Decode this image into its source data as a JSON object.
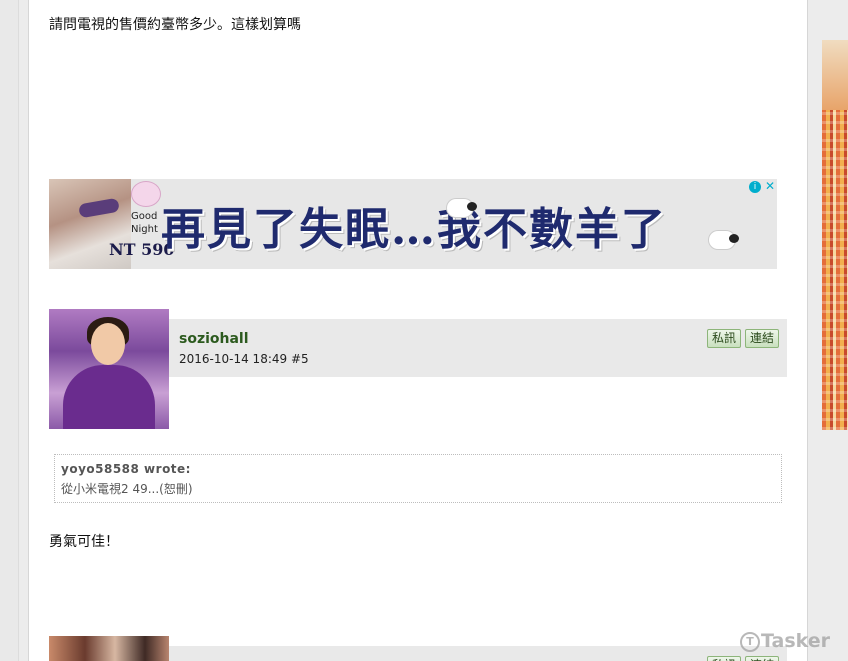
{
  "post1": {
    "text": "請問電視的售價約臺幣多少。這樣划算嗎"
  },
  "ad_banner": {
    "brand_small": "Good Night",
    "price": "NT 590",
    "headline": "再見了失眠…我不數羊了",
    "info_icon": "info-icon",
    "close_icon": "close-icon"
  },
  "post2": {
    "username": "soziohall",
    "timestamp": "2016-10-14 18:49",
    "post_number": "#5",
    "pm_button": "私訊",
    "link_button": "連結",
    "quote": {
      "author": "yoyo58588 wrote:",
      "text": "從小米電視2 49...(恕刪)"
    },
    "text": "勇氣可佳！"
  },
  "post3": {
    "pm_button": "私訊",
    "link_button": "連結"
  },
  "watermark": {
    "text": "Tasker",
    "icon_letter": "T"
  }
}
